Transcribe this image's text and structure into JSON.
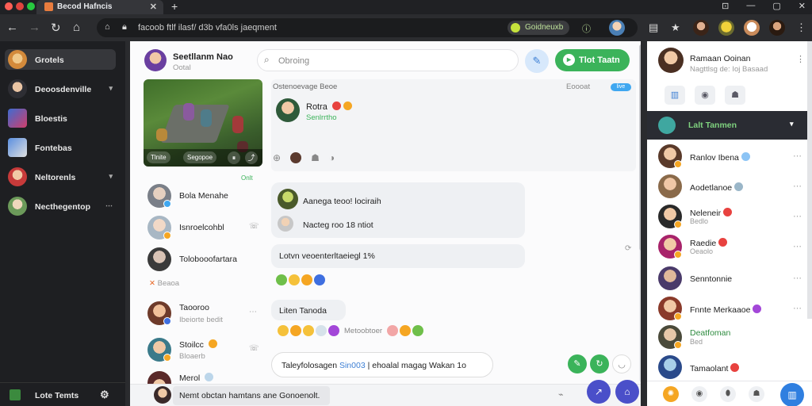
{
  "browser": {
    "tab_title": "Becod Hafncis",
    "tab_close": "✕",
    "new_tab": "+",
    "url": "facoob ftlf ilasf/ d3b vfa0ls jaeqment",
    "extension_label": "Goidneuxb",
    "window_controls": [
      "⊡",
      "—",
      "▢",
      "✕"
    ]
  },
  "sidebar": {
    "items": [
      {
        "label": "Grotels",
        "active": true,
        "caret": false
      },
      {
        "label": "Deoosdenville",
        "active": false,
        "caret": true
      },
      {
        "label": "Bloestis",
        "active": false,
        "caret": false
      },
      {
        "label": "Fontebas",
        "active": false,
        "caret": false
      },
      {
        "label": "Neltorenls",
        "active": false,
        "caret": true
      },
      {
        "label": "Necthegentop",
        "active": false,
        "caret": true
      }
    ],
    "footer_label": "Lote Temts"
  },
  "header": {
    "name": "Seetllanm Nao",
    "subtitle": "Ootal",
    "search_placeholder": "Obroing",
    "cta_label": "Tlot Taatn"
  },
  "game_card": {
    "buttons": [
      "Tlnite",
      "Segopoe"
    ]
  },
  "post": {
    "title": "Ostenoevage Beoe",
    "meta": "Eoooat",
    "badge": "live",
    "author": "Rotra",
    "status": "Senlrrtho"
  },
  "online_tag": "Onlt",
  "contacts": [
    {
      "name": "Bola Menahe",
      "sub": "",
      "green": false
    },
    {
      "name": "Isnroelcohbl",
      "sub": "",
      "green": false
    },
    {
      "name": "Tolobooofartara",
      "sub": "",
      "green": false
    },
    {
      "name": "Taooroo",
      "sub": "Ibeiorte bedit",
      "green": false
    },
    {
      "name": "Stoilcc",
      "sub": "Bloaerb",
      "green": false
    },
    {
      "name": "Merol",
      "sub": "",
      "green": false
    }
  ],
  "side_label": "Beaoa",
  "messages": [
    {
      "text": "Aanega teoo! lociraih"
    },
    {
      "text": "Nacteg roo  18  ntiot"
    },
    {
      "text": "Lotvn veoenterltaeiegl 1%"
    },
    {
      "text": "Liten Tanoda"
    },
    {
      "text": "Metoobtoer"
    }
  ],
  "chat_input": {
    "prefix": "Taleyfolosagen ",
    "highlight": "Sin003",
    "suffix": " |  ehoalal magag Wakan 1o"
  },
  "bottom_bar": {
    "input_text": "Nemt obctan hamtans ane Gonoenolt."
  },
  "right_panel": {
    "profile_name": "Ramaan Ooinan",
    "profile_sub": "Nagttlsg de: Ioj Basaad",
    "section_title": "Lalt Tanmen",
    "friends": [
      {
        "name": "Ranlov Ibena",
        "sub": "",
        "green": false,
        "emoji": "#8cc4f5"
      },
      {
        "name": "Aodetlanoe",
        "sub": "",
        "green": false,
        "emoji": "#9ab6c8"
      },
      {
        "name": "Neleneir",
        "sub": "Bedlo",
        "green": false,
        "emoji": "#e8423f"
      },
      {
        "name": "Raedie",
        "sub": "Oeaolo",
        "green": false,
        "emoji": "#e8423f"
      },
      {
        "name": "Senntonnie",
        "sub": "",
        "green": false,
        "emoji": ""
      },
      {
        "name": "Fnnte Merkaaoe",
        "sub": "",
        "green": false,
        "emoji": "#a347d8"
      },
      {
        "name": "Deatfoman",
        "sub": "Bed",
        "green": true,
        "emoji": ""
      },
      {
        "name": "Tamaolant",
        "sub": "",
        "green": false,
        "emoji": "#e8423f"
      }
    ]
  },
  "colors": {
    "accent_green": "#3bb35a",
    "accent_blue": "#2f7fe0",
    "dark_bg": "#1e1f22"
  }
}
